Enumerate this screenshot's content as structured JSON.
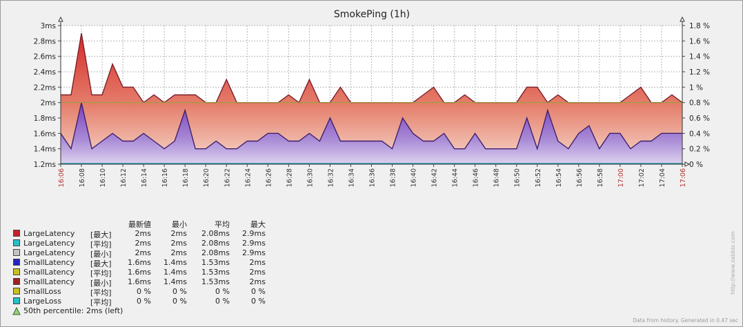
{
  "chart_data": {
    "type": "area",
    "title": "SmokePing (1h)",
    "x_ticks": [
      "16:06",
      "16:08",
      "16:10",
      "16:12",
      "16:14",
      "16:16",
      "16:18",
      "16:20",
      "16:22",
      "16:24",
      "16:26",
      "16:28",
      "16:30",
      "16:32",
      "16:34",
      "16:36",
      "16:38",
      "16:40",
      "16:42",
      "16:44",
      "16:46",
      "16:48",
      "16:50",
      "16:52",
      "16:54",
      "16:56",
      "16:58",
      "17:00",
      "17:02",
      "17:04",
      "17:06"
    ],
    "x_highlight": [
      "16:06",
      "17:00",
      "17:06"
    ],
    "y_ticks_left": [
      "1.2ms",
      "1.4ms",
      "1.6ms",
      "1.8ms",
      "2ms",
      "2.2ms",
      "2.4ms",
      "2.6ms",
      "2.8ms",
      "3ms"
    ],
    "y_ticks_right": [
      "0 %",
      "0.2 %",
      "0.4 %",
      "0.6 %",
      "0.8 %",
      "1 %",
      "1.2 %",
      "1.4 %",
      "1.6 %",
      "1.8 %"
    ],
    "ylim_left_ms": [
      1.2,
      3.0
    ],
    "ylim_right_pct": [
      0,
      1.8
    ],
    "grid": true,
    "percentile_line_ms": 2.0,
    "series": [
      {
        "name": "LargeLatency [最大]",
        "color": "#c8202a",
        "minutes": [
          0,
          1,
          2,
          3,
          4,
          5,
          6,
          7,
          8,
          9,
          10,
          11,
          12,
          13,
          14,
          15,
          16,
          17,
          18,
          19,
          20,
          21,
          22,
          23,
          24,
          25,
          26,
          27,
          28,
          29,
          30,
          31,
          32,
          33,
          34,
          35,
          36,
          37,
          38,
          39,
          40,
          41,
          42,
          43,
          44,
          45,
          46,
          47,
          48,
          49,
          50,
          51,
          52,
          53,
          54,
          55,
          56,
          57,
          58,
          59,
          60
        ],
        "values": [
          2.1,
          2.1,
          2.9,
          2.1,
          2.1,
          2.5,
          2.2,
          2.2,
          2.0,
          2.1,
          2.0,
          2.1,
          2.1,
          2.1,
          2.0,
          2.0,
          2.3,
          2.0,
          2.0,
          2.0,
          2.0,
          2.0,
          2.1,
          2.0,
          2.3,
          2.0,
          2.0,
          2.2,
          2.0,
          2.0,
          2.0,
          2.0,
          2.0,
          2.0,
          2.0,
          2.1,
          2.2,
          2.0,
          2.0,
          2.1,
          2.0,
          2.0,
          2.0,
          2.0,
          2.0,
          2.2,
          2.2,
          2.0,
          2.1,
          2.0,
          2.0,
          2.0,
          2.0,
          2.0,
          2.0,
          2.1,
          2.2,
          2.0,
          2.0,
          2.1,
          2.0,
          2.1,
          2.0,
          2.0
        ]
      },
      {
        "name": "SmallLatency [最小]",
        "color": "#6a3fb0",
        "minutes": [
          0,
          1,
          2,
          3,
          4,
          5,
          6,
          7,
          8,
          9,
          10,
          11,
          12,
          13,
          14,
          15,
          16,
          17,
          18,
          19,
          20,
          21,
          22,
          23,
          24,
          25,
          26,
          27,
          28,
          29,
          30,
          31,
          32,
          33,
          34,
          35,
          36,
          37,
          38,
          39,
          40,
          41,
          42,
          43,
          44,
          45,
          46,
          47,
          48,
          49,
          50,
          51,
          52,
          53,
          54,
          55,
          56,
          57,
          58,
          59,
          60
        ],
        "values": [
          1.6,
          1.4,
          2.0,
          1.4,
          1.5,
          1.6,
          1.5,
          1.5,
          1.6,
          1.5,
          1.4,
          1.5,
          1.9,
          1.4,
          1.4,
          1.5,
          1.4,
          1.4,
          1.5,
          1.5,
          1.6,
          1.6,
          1.5,
          1.5,
          1.6,
          1.5,
          1.8,
          1.5,
          1.5,
          1.5,
          1.5,
          1.5,
          1.4,
          1.8,
          1.6,
          1.5,
          1.5,
          1.6,
          1.4,
          1.4,
          1.6,
          1.4,
          1.4,
          1.4,
          1.4,
          1.8,
          1.4,
          1.9,
          1.5,
          1.4,
          1.6,
          1.7,
          1.4,
          1.6,
          1.6,
          1.4,
          1.5,
          1.5,
          1.6,
          1.6,
          1.6
        ]
      },
      {
        "name": "SmallLoss [平均]",
        "color": "#2a9aa8",
        "values_pct": [
          0
        ]
      },
      {
        "name": "LargeLoss [平均]",
        "color": "#2a9aa8",
        "values_pct": [
          0
        ]
      }
    ]
  },
  "legend": {
    "headers": [
      "最新値",
      "最小",
      "平均",
      "最大"
    ],
    "rows": [
      {
        "swatch": "#c8202a",
        "name": "LargeLatency",
        "fn": "[最大]",
        "last": "2ms",
        "min": "2ms",
        "avg": "2.08ms",
        "max": "2.9ms"
      },
      {
        "swatch": "#26c0c8",
        "name": "LargeLatency",
        "fn": "[平均]",
        "last": "2ms",
        "min": "2ms",
        "avg": "2.08ms",
        "max": "2.9ms"
      },
      {
        "swatch": "#c4c4c4",
        "name": "LargeLatency",
        "fn": "[最小]",
        "last": "2ms",
        "min": "2ms",
        "avg": "2.08ms",
        "max": "2.9ms"
      },
      {
        "swatch": "#2424c0",
        "name": "SmallLatency",
        "fn": "[最大]",
        "last": "1.6ms",
        "min": "1.4ms",
        "avg": "1.53ms",
        "max": "2ms"
      },
      {
        "swatch": "#c8c020",
        "name": "SmallLatency",
        "fn": "[平均]",
        "last": "1.6ms",
        "min": "1.4ms",
        "avg": "1.53ms",
        "max": "2ms"
      },
      {
        "swatch": "#a02020",
        "name": "SmallLatency",
        "fn": "[最小]",
        "last": "1.6ms",
        "min": "1.4ms",
        "avg": "1.53ms",
        "max": "2ms"
      },
      {
        "swatch": "#c8c020",
        "name": "SmallLoss",
        "fn": "[平均]",
        "last": "0 %",
        "min": "0 %",
        "avg": "0 %",
        "max": "0 %"
      },
      {
        "swatch": "#26c0c8",
        "name": "LargeLoss",
        "fn": "[平均]",
        "last": "0 %",
        "min": "0 %",
        "avg": "0 %",
        "max": "0 %"
      }
    ],
    "percentile_label": "50th percentile: 2ms (left)"
  },
  "watermark": "http://www.zabbix.com",
  "footer": "Data from history. Generated in 0.47 sec"
}
